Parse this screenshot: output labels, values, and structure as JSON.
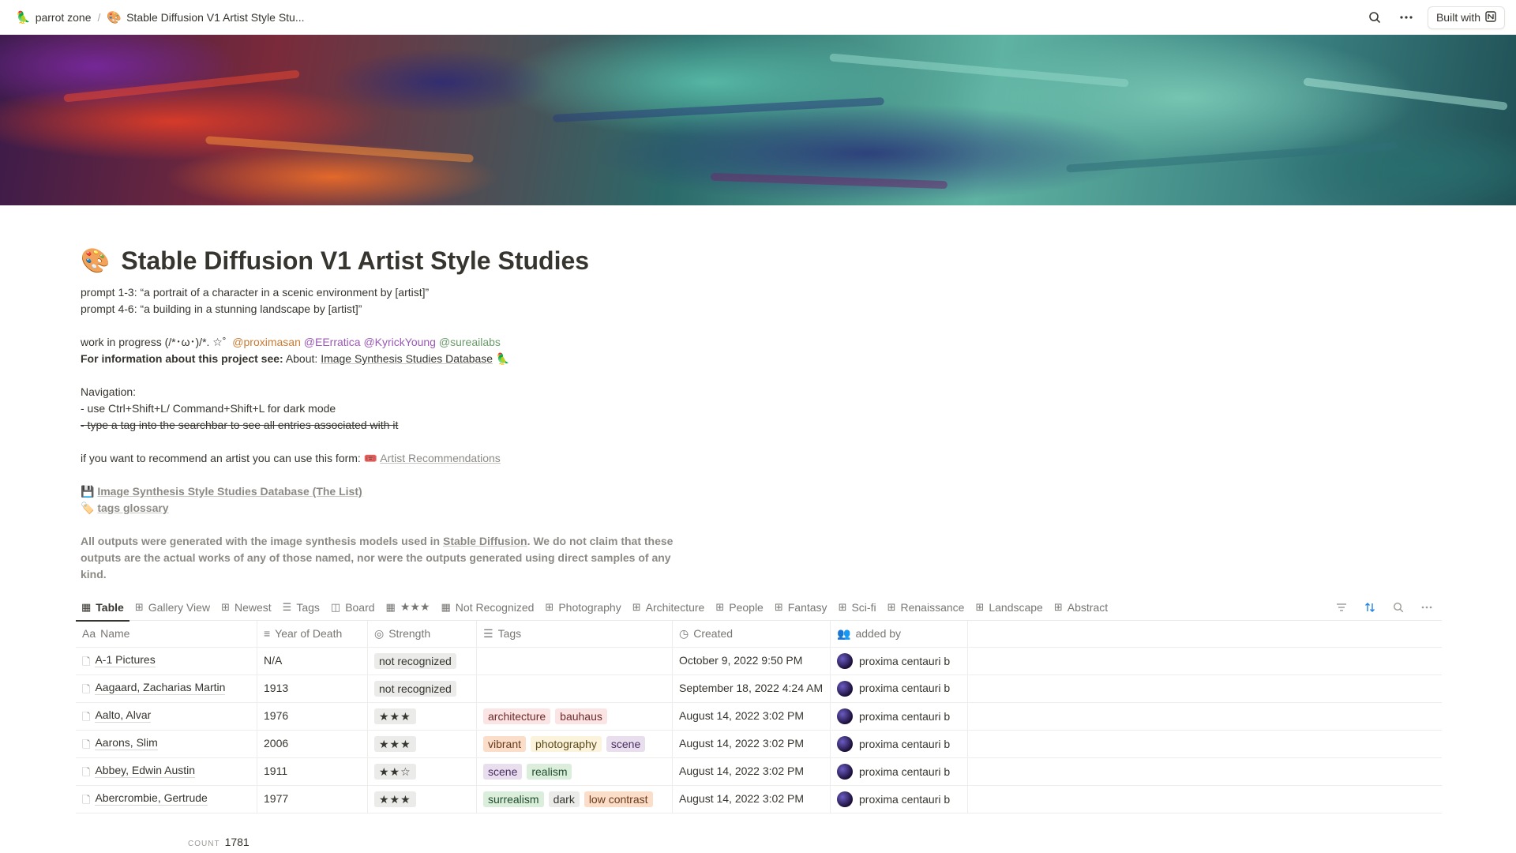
{
  "breadcrumb": {
    "workspace_emoji": "🦜",
    "workspace": "parrot zone",
    "page_emoji": "🎨",
    "page": "Stable Diffusion V1 Artist Style Stu..."
  },
  "topbar": {
    "built_with": "Built with"
  },
  "page": {
    "emoji": "🎨",
    "title": "Stable Diffusion V1 Artist Style Studies",
    "prompt1": "prompt 1-3: “a portrait of a character in a scenic environment by [artist]”",
    "prompt2": "prompt 4-6: “a building in a stunning landscape by [artist]”",
    "wip": "work in progress (/*･ω･)/*. ☆˚",
    "mentions": [
      "@proximasan",
      "@EErratica",
      "@KyrickYoung",
      "@sureailabs"
    ],
    "info_bold": "For information about this project see:",
    "info_about": "About:",
    "info_link": "Image Synthesis Studies Database",
    "info_emoji": "🦜",
    "nav_title": "Navigation:",
    "nav_1": "- use Ctrl+Shift+L/ Command+Shift+L for dark mode",
    "nav_2": "- type a tag into the searchbar to see all entries associated with it",
    "recommend_text": "if you want to recommend an artist you can use this form:",
    "recommend_emoji": "🎟️",
    "recommend_link": "Artist Recommendations",
    "link1_emoji": "💾",
    "link1": "Image Synthesis Style Studies Database (The List)",
    "link2_emoji": "🏷️",
    "link2": "tags glossary",
    "disclaimer_1": "All outputs were generated with the image synthesis models used in",
    "disclaimer_link": "Stable Diffusion",
    "disclaimer_2": ". We do not claim that these outputs are the actual works of any of those named, nor were the outputs generated using direct samples of any kind."
  },
  "tabs": [
    {
      "icon": "table-icon",
      "label": "Table",
      "active": true
    },
    {
      "icon": "gallery-icon",
      "label": "Gallery View"
    },
    {
      "icon": "gallery-icon",
      "label": "Newest"
    },
    {
      "icon": "list-icon",
      "label": "Tags"
    },
    {
      "icon": "board-icon",
      "label": "Board"
    },
    {
      "icon": "table-icon",
      "label": "★★★"
    },
    {
      "icon": "table-icon",
      "label": "Not Recognized"
    },
    {
      "icon": "gallery-icon",
      "label": "Photography"
    },
    {
      "icon": "gallery-icon",
      "label": "Architecture"
    },
    {
      "icon": "gallery-icon",
      "label": "People"
    },
    {
      "icon": "gallery-icon",
      "label": "Fantasy"
    },
    {
      "icon": "gallery-icon",
      "label": "Sci-fi"
    },
    {
      "icon": "gallery-icon",
      "label": "Renaissance"
    },
    {
      "icon": "gallery-icon",
      "label": "Landscape"
    },
    {
      "icon": "gallery-icon",
      "label": "Abstract"
    }
  ],
  "columns": {
    "name": "Name",
    "year": "Year of Death",
    "strength": "Strength",
    "tags": "Tags",
    "created": "Created",
    "added_by": "added by"
  },
  "rows": [
    {
      "name": "A-1 Pictures",
      "year": "N/A",
      "strength": "not recognized",
      "tags": [],
      "created": "October 9, 2022 9:50 PM",
      "added_by": "proxima centauri b"
    },
    {
      "name": "Aagaard, Zacharias Martin",
      "year": "1913",
      "strength": "not recognized",
      "tags": [],
      "created": "September 18, 2022 4:24 AM",
      "added_by": "proxima centauri b"
    },
    {
      "name": "Aalto, Alvar",
      "year": "1976",
      "strength": "★★★",
      "tags": [
        {
          "t": "architecture",
          "c": "red"
        },
        {
          "t": "bauhaus",
          "c": "red"
        }
      ],
      "created": "August 14, 2022 3:02 PM",
      "added_by": "proxima centauri b"
    },
    {
      "name": "Aarons, Slim",
      "year": "2006",
      "strength": "★★★",
      "tags": [
        {
          "t": "vibrant",
          "c": "orange"
        },
        {
          "t": "photography",
          "c": "yellow"
        },
        {
          "t": "scene",
          "c": "purple"
        }
      ],
      "created": "August 14, 2022 3:02 PM",
      "added_by": "proxima centauri b"
    },
    {
      "name": "Abbey, Edwin Austin",
      "year": "1911",
      "strength": "★★☆",
      "tags": [
        {
          "t": "scene",
          "c": "purple"
        },
        {
          "t": "realism",
          "c": "green"
        }
      ],
      "created": "August 14, 2022 3:02 PM",
      "added_by": "proxima centauri b"
    },
    {
      "name": "Abercrombie, Gertrude",
      "year": "1977",
      "strength": "★★★",
      "tags": [
        {
          "t": "surrealism",
          "c": "green"
        },
        {
          "t": "dark",
          "c": "gray"
        },
        {
          "t": "low contrast",
          "c": "orange"
        }
      ],
      "created": "August 14, 2022 3:02 PM",
      "added_by": "proxima centauri b"
    }
  ],
  "footer": {
    "count_label": "COUNT",
    "count_value": "1781"
  }
}
